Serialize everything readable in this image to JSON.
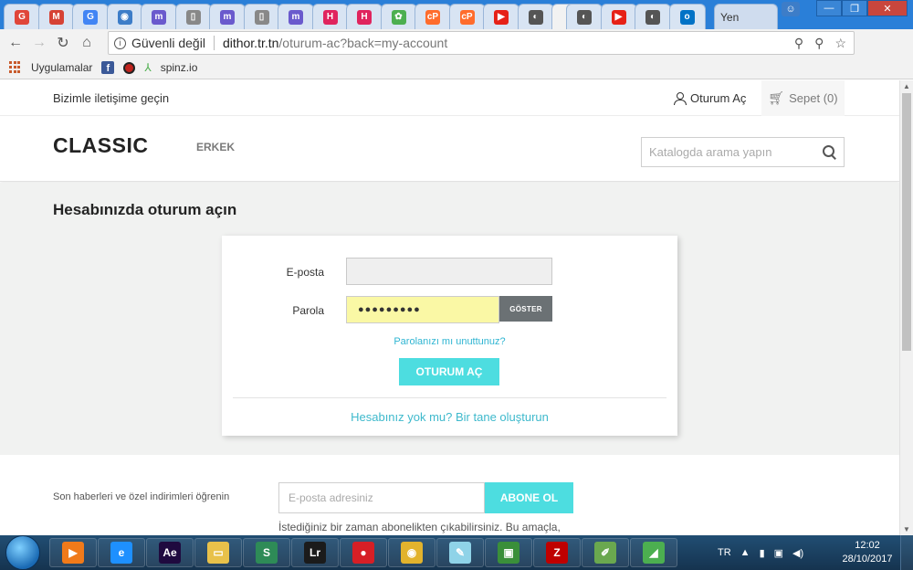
{
  "browser": {
    "tabs": [
      {
        "icon": "google-icon",
        "glyph": "G",
        "color": "#e0463a"
      },
      {
        "icon": "gmail-icon",
        "glyph": "M",
        "color": "#d64235"
      },
      {
        "icon": "google-icon",
        "glyph": "G",
        "color": "#4285f4"
      },
      {
        "icon": "circle-icon",
        "glyph": "◉",
        "color": "#3d7dc8"
      },
      {
        "icon": "m-icon",
        "glyph": "m",
        "color": "#6a5acd"
      },
      {
        "icon": "page-icon",
        "glyph": "▯",
        "color": "#888888"
      },
      {
        "icon": "m-icon",
        "glyph": "m",
        "color": "#6a5acd"
      },
      {
        "icon": "page-icon",
        "glyph": "▯",
        "color": "#888888"
      },
      {
        "icon": "m-icon",
        "glyph": "m",
        "color": "#6a5acd"
      },
      {
        "icon": "h-icon",
        "glyph": "H",
        "color": "#e0245e"
      },
      {
        "icon": "h-icon",
        "glyph": "H",
        "color": "#e0245e"
      },
      {
        "icon": "frog-icon",
        "glyph": "✿",
        "color": "#4caf50"
      },
      {
        "icon": "cpanel-icon",
        "glyph": "cP",
        "color": "#ff6c2c"
      },
      {
        "icon": "cpanel-icon",
        "glyph": "cP",
        "color": "#ff6c2c"
      },
      {
        "icon": "youtube-icon",
        "glyph": "▶",
        "color": "#e62117"
      },
      {
        "icon": "eye-icon",
        "glyph": "◐",
        "color": "#555555"
      },
      {
        "icon": "eye-icon",
        "glyph": "◐",
        "color": "#555555"
      },
      {
        "icon": "youtube-icon",
        "glyph": "▶",
        "color": "#e62117"
      },
      {
        "icon": "eye-icon",
        "glyph": "◐",
        "color": "#555555"
      },
      {
        "icon": "outlook-icon",
        "glyph": "o",
        "color": "#0072c6"
      }
    ],
    "new_tab_label": "Yen",
    "address": {
      "security": "Güvenli değil",
      "host": "dithor.tr.tn",
      "path": "/oturum-ac?back=my-account"
    },
    "bookmarks": {
      "apps": "Uygulamalar",
      "spinz": "spinz.io"
    }
  },
  "site": {
    "topbar": {
      "contact": "Bizimle iletişime geçin",
      "sign_in": "Oturum Aç",
      "cart": "Sepet (0)"
    },
    "header": {
      "logo": "CLASSIC",
      "menu_item": "ERKEK",
      "search_placeholder": "Katalogda arama yapın"
    },
    "login": {
      "title": "Hesabınızda oturum açın",
      "email_label": "E-posta",
      "password_label": "Parola",
      "password_value": "●●●●●●●●●",
      "show_button": "GÖSTER",
      "forgot_link": "Parolanızı mı unuttunuz?",
      "submit_button": "OTURUM AÇ",
      "create_account_link": "Hesabınız yok mu? Bir tane oluşturun"
    },
    "newsletter": {
      "text": "Son haberleri ve özel indirimleri öğrenin",
      "placeholder": "E-posta adresiniz",
      "button": "ABONE OL",
      "note": "İstediğiniz bir zaman abonelikten çıkabilirsiniz. Bu amaçla,"
    }
  },
  "taskbar": {
    "apps": [
      {
        "name": "media-player-icon",
        "glyph": "▶",
        "color": "#f07a1a"
      },
      {
        "name": "ie-icon",
        "glyph": "e",
        "color": "#1e90ff"
      },
      {
        "name": "after-effects-icon",
        "glyph": "Ae",
        "color": "#1f0a3f"
      },
      {
        "name": "explorer-icon",
        "glyph": "▭",
        "color": "#e8c14a"
      },
      {
        "name": "app-s-icon",
        "glyph": "S",
        "color": "#2e8b57"
      },
      {
        "name": "lightroom-icon",
        "glyph": "Lr",
        "color": "#1b1b1b"
      },
      {
        "name": "recorder-icon",
        "glyph": "●",
        "color": "#d61f26"
      },
      {
        "name": "chrome-icon",
        "glyph": "◉",
        "color": "#e2b32d"
      },
      {
        "name": "notepad-icon",
        "glyph": "✎",
        "color": "#8fd3e8"
      },
      {
        "name": "monitor-icon",
        "glyph": "▣",
        "color": "#3a8f3a"
      },
      {
        "name": "filezilla-icon",
        "glyph": "Z",
        "color": "#bf0000"
      },
      {
        "name": "paint-icon",
        "glyph": "✐",
        "color": "#6aa84f"
      },
      {
        "name": "green-app-icon",
        "glyph": "◢",
        "color": "#4caf50"
      }
    ],
    "lang": "TR",
    "time": "12:02",
    "date": "28/10/2017"
  }
}
